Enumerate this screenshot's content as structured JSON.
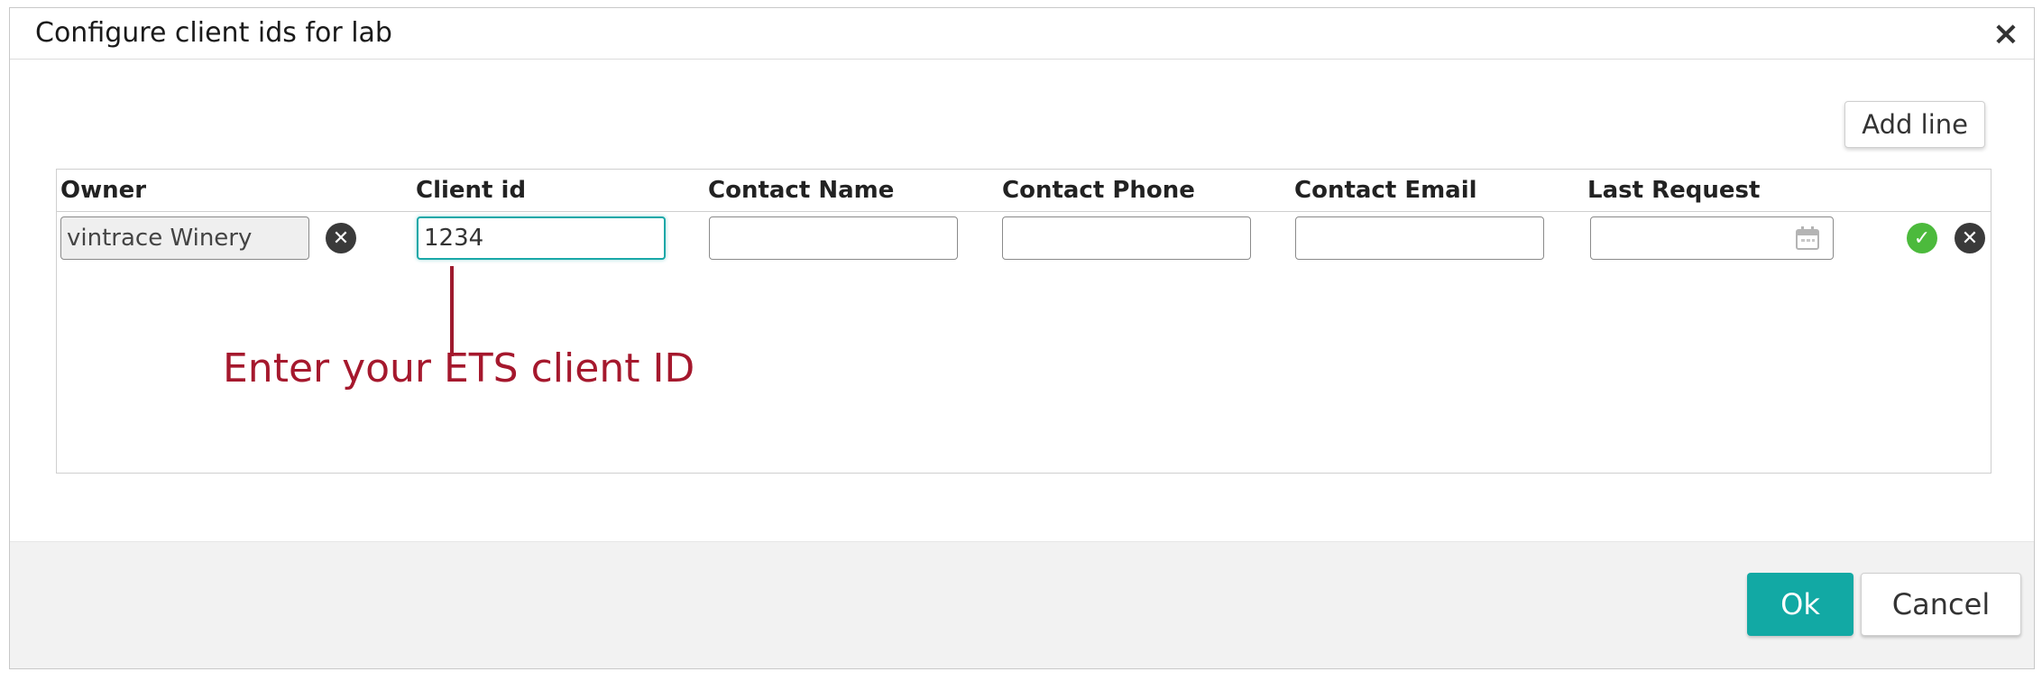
{
  "dialog": {
    "title": "Configure client ids for lab",
    "close_icon": "close-icon"
  },
  "toolbar": {
    "add_line_label": "Add line"
  },
  "table": {
    "headers": [
      "Owner",
      "Client id",
      "Contact Name",
      "Contact Phone",
      "Contact Email",
      "Last Request"
    ],
    "row": {
      "owner": "vintrace Winery",
      "client_id": "1234",
      "contact_name": "",
      "contact_phone": "",
      "contact_email": "",
      "last_request": ""
    }
  },
  "annotation": {
    "text": "Enter your ETS client ID"
  },
  "footer": {
    "ok_label": "Ok",
    "cancel_label": "Cancel"
  },
  "colors": {
    "accent": "#12a9a4",
    "annotation": "#a5182d",
    "confirm": "#4cba3c"
  },
  "icons": [
    "close-icon",
    "clear-owner-icon",
    "calendar-icon",
    "confirm-row-icon",
    "delete-row-icon"
  ]
}
